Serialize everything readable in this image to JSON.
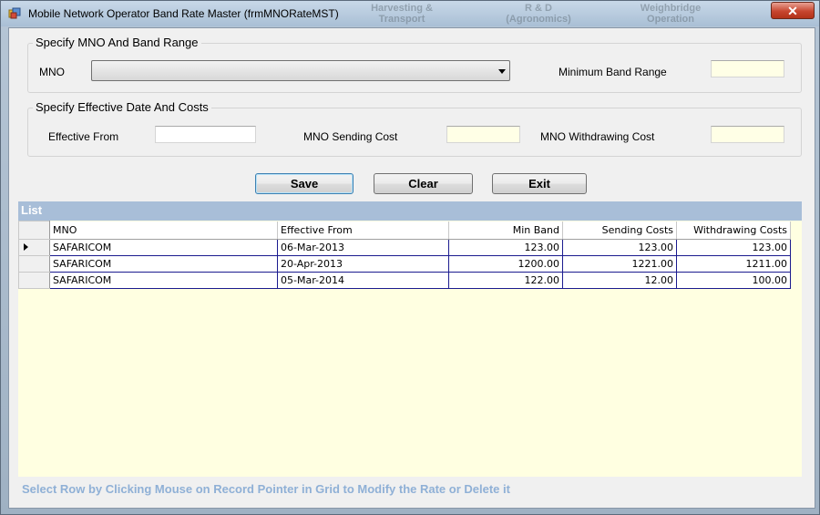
{
  "window": {
    "title": "Mobile Network Operator Band Rate Master (frmMNORateMST)",
    "close_label": "✕",
    "background_tabs": [
      "Harvesting &\nTransport",
      "R & D\n(Agronomics)",
      "Weighbridge\nOperation"
    ]
  },
  "group_mno": {
    "title": "Specify MNO And Band Range",
    "mno_label": "MNO",
    "mno_value": "",
    "min_band_label": "Minimum Band Range",
    "min_band_value": ""
  },
  "group_dates": {
    "title": "Specify Effective Date And Costs",
    "effective_from_label": "Effective From",
    "effective_from_value": "",
    "sending_cost_label": "MNO Sending Cost",
    "sending_cost_value": "",
    "withdrawing_cost_label": "MNO Withdrawing Cost",
    "withdrawing_cost_value": ""
  },
  "buttons": {
    "save": "Save",
    "clear": "Clear",
    "exit": "Exit"
  },
  "list": {
    "title": "List",
    "columns": [
      "MNO",
      "Effective From",
      "Min Band",
      "Sending Costs",
      "Withdrawing Costs"
    ],
    "rows": [
      [
        "SAFARICOM",
        "06-Mar-2013",
        "123.00",
        "123.00",
        "123.00"
      ],
      [
        "SAFARICOM",
        "20-Apr-2013",
        "1200.00",
        "1221.00",
        "1211.00"
      ],
      [
        "SAFARICOM",
        "05-Mar-2014",
        "122.00",
        "12.00",
        "100.00"
      ]
    ],
    "selected_row": 0
  },
  "hint": "Select Row by Clicking Mouse on Record Pointer in Grid to Modify the Rate or Delete it",
  "colors": {
    "list_header": "#a8bed8",
    "input_yellow": "#ffffe6",
    "hint": "#8fb0d6",
    "close_red": "#c7462f"
  }
}
